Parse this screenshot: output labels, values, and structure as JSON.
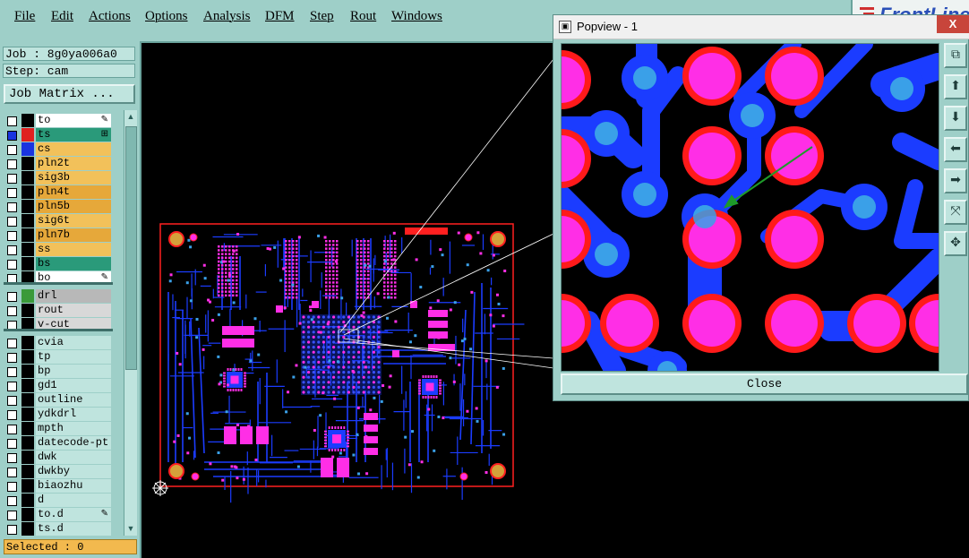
{
  "menubar": {
    "items": [
      "File",
      "Edit",
      "Actions",
      "Options",
      "Analysis",
      "DFM",
      "Step",
      "Rout",
      "Windows"
    ],
    "brand": "FrontLine"
  },
  "left_panel": {
    "job": "Job : 8g0ya006a0",
    "step": "Step: cam",
    "job_matrix_label": "Job Matrix ...",
    "layers": [
      {
        "name": "to",
        "color": "#ffffff",
        "swatch": "#000000",
        "mark": "✎"
      },
      {
        "name": "ts",
        "color": "#2a9a7a",
        "swatch": "#e02020",
        "mark": "⊞"
      },
      {
        "name": "cs",
        "color": "#f2c15a",
        "swatch": "#1a34e0",
        "mark": ""
      },
      {
        "name": "pln2t",
        "color": "#f2c15a",
        "swatch": "",
        "mark": ""
      },
      {
        "name": "sig3b",
        "color": "#f2c15a",
        "swatch": "",
        "mark": ""
      },
      {
        "name": "pln4t",
        "color": "#e6a83a",
        "swatch": "",
        "mark": ""
      },
      {
        "name": "pln5b",
        "color": "#e6a83a",
        "swatch": "",
        "mark": ""
      },
      {
        "name": "sig6t",
        "color": "#f2c15a",
        "swatch": "",
        "mark": ""
      },
      {
        "name": "pln7b",
        "color": "#e6a83a",
        "swatch": "",
        "mark": ""
      },
      {
        "name": "ss",
        "color": "#f2c15a",
        "swatch": "",
        "mark": ""
      },
      {
        "name": "bs",
        "color": "#2a9a7a",
        "swatch": "",
        "mark": ""
      },
      {
        "name": "bo",
        "color": "#ffffff",
        "swatch": "",
        "mark": "✎"
      },
      {
        "name": "drl",
        "color": "#b8b8b8",
        "swatch": "#3a9a3a",
        "mark": ""
      },
      {
        "name": "rout",
        "color": "#d8d8d8",
        "swatch": "",
        "mark": ""
      },
      {
        "name": "v-cut",
        "color": "#d8d8d8",
        "swatch": "",
        "mark": ""
      },
      {
        "name": "cvia",
        "color": "#bfe4de",
        "swatch": "",
        "mark": ""
      },
      {
        "name": "tp",
        "color": "#bfe4de",
        "swatch": "",
        "mark": ""
      },
      {
        "name": "bp",
        "color": "#bfe4de",
        "swatch": "",
        "mark": ""
      },
      {
        "name": "gd1",
        "color": "#bfe4de",
        "swatch": "",
        "mark": ""
      },
      {
        "name": "outline",
        "color": "#bfe4de",
        "swatch": "",
        "mark": ""
      },
      {
        "name": "ydkdrl",
        "color": "#bfe4de",
        "swatch": "",
        "mark": ""
      },
      {
        "name": "mpth",
        "color": "#bfe4de",
        "swatch": "",
        "mark": ""
      },
      {
        "name": "datecode-pt",
        "color": "#bfe4de",
        "swatch": "",
        "mark": ""
      },
      {
        "name": "dwk",
        "color": "#bfe4de",
        "swatch": "",
        "mark": ""
      },
      {
        "name": "dwkby",
        "color": "#bfe4de",
        "swatch": "",
        "mark": ""
      },
      {
        "name": "biaozhu",
        "color": "#bfe4de",
        "swatch": "",
        "mark": ""
      },
      {
        "name": "d",
        "color": "#bfe4de",
        "swatch": "",
        "mark": ""
      },
      {
        "name": "to.d",
        "color": "#bfe4de",
        "swatch": "",
        "mark": "✎"
      },
      {
        "name": "ts.d",
        "color": "#bfe4de",
        "swatch": "",
        "mark": ""
      }
    ],
    "selected": "Selected : 0"
  },
  "popview": {
    "title": "Popview - 1",
    "close_x": "X",
    "close_button": "Close"
  },
  "colors": {
    "pad_magenta": "#ff2ee6",
    "pad_ring_red": "#ff1a1a",
    "trace_blue": "#1b3cff",
    "via_cyan": "#3aa0e8",
    "board_outline": "#ff2020"
  }
}
